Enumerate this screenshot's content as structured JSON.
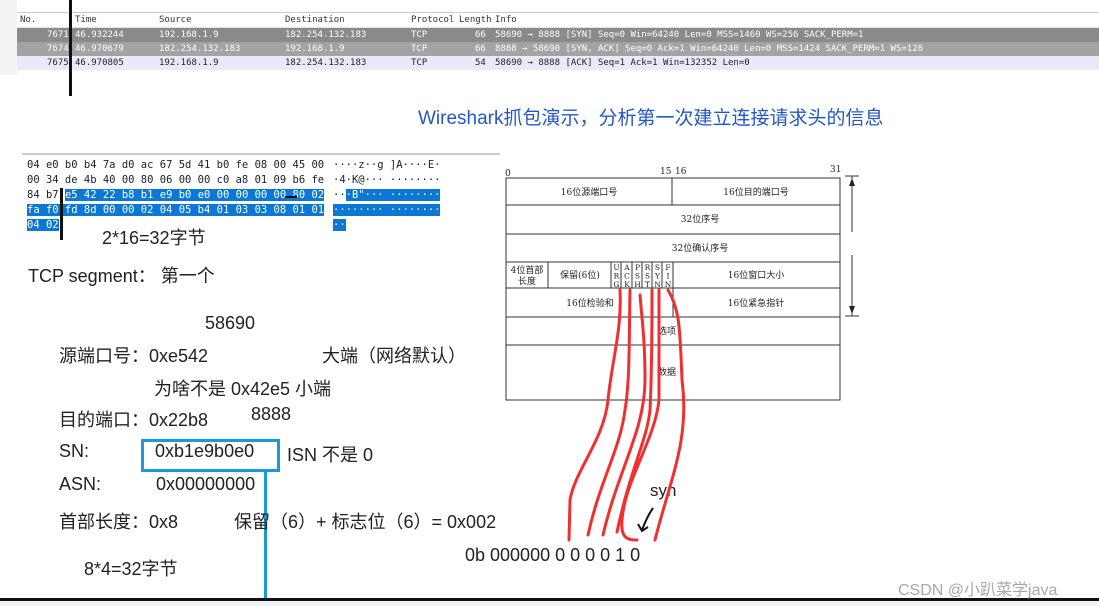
{
  "packet_list": {
    "columns": [
      "No.",
      "Time",
      "Source",
      "Destination",
      "Protocol",
      "Length",
      "Info"
    ],
    "rows": [
      {
        "no": "7671",
        "time": "46.932244",
        "source": "192.168.1.9",
        "destination": "182.254.132.183",
        "protocol": "TCP",
        "length": "66",
        "info": "58690 → 8888 [SYN] Seq=0 Win=64240 Len=0 MSS=1460 WS=256 SACK_PERM=1"
      },
      {
        "no": "7674",
        "time": "46.970679",
        "source": "182.254.132.183",
        "destination": "192.168.1.9",
        "protocol": "TCP",
        "length": "66",
        "info": "8888 → 58690 [SYN, ACK] Seq=0 Ack=1 Win=64240 Len=0 MSS=1424 SACK_PERM=1 WS=128"
      },
      {
        "no": "7675",
        "time": "46.970805",
        "source": "192.168.1.9",
        "destination": "182.254.132.183",
        "protocol": "TCP",
        "length": "54",
        "info": "58690 → 8888 [ACK] Seq=1 Ack=1 Win=132352 Len=0"
      }
    ]
  },
  "title": "Wireshark抓包演示，分析第一次建立连接请求头的信息",
  "hex_dump": {
    "lines": [
      {
        "plain": "04 e0 b0 b4 7a d0 ac 67  5d 41 b0 fe 08 00 45 00",
        "sel": "",
        "ascii": "····z··g ]A····E·",
        "ascii_sel": ""
      },
      {
        "plain": "00 34 de 4b 40 00 80 06  00 00 c0 a8 01 09 b6 fe",
        "sel": "",
        "ascii": "·4·K@··· ········",
        "ascii_sel": ""
      },
      {
        "plain": "84 b7 ",
        "sel": "e5 42 22 b8 b1 e9  b0 e0 00 00 00 00 80 02",
        "ascii": "··",
        "ascii_sel": "·B\"··· ········"
      },
      {
        "plain": "",
        "sel": "fa f0 fd 8d 00 00 02 04  05 b4 01 03 03 08 01 01",
        "ascii": "",
        "ascii_sel": "········ ········"
      },
      {
        "plain": "",
        "sel": "04 02",
        "ascii": "",
        "ascii_sel": "··"
      }
    ]
  },
  "notes": {
    "bytes_count": "2*16=32字节",
    "segment": "TCP segment： 第一个",
    "src_port_dec": "58690",
    "src_port_label": "源端口号：0xe542",
    "big_endian": "大端（网络默认）",
    "why_not": "为啥不是 0x42e5   小端",
    "dst_port_label": "目的端口：0x22b8",
    "dst_port_dec": "8888",
    "sn_label": "SN:",
    "sn_value": "0xb1e9b0e0",
    "isn_note": "ISN 不是 0",
    "asn_label": "ASN:",
    "asn_value": "0x00000000",
    "header_len": "首部长度：0x8",
    "reserved_flags": "保留（6）+ 标志位（6）= 0x002",
    "header_bytes": "8*4=32字节",
    "syn": "syn",
    "binary": "0b 000000 0 0 0 0 1 0"
  },
  "diagram": {
    "bit_0": "0",
    "bit_15": "15",
    "bit_16": "16",
    "bit_31": "31",
    "src_port": "16位源端口号",
    "dst_port": "16位目的端口号",
    "seq": "32位序号",
    "ack": "32位确认序号",
    "hdr_len": [
      "4位首部",
      "长度"
    ],
    "reserved": "保留(6位)",
    "flags": [
      "URG",
      "ACK",
      "PSH",
      "RST",
      "SYN",
      "FIN"
    ],
    "window": "16位窗口大小",
    "checksum": "16位检验和",
    "urgent": "16位紧急指针",
    "options": "选项",
    "data": "数据"
  },
  "colors": {
    "accent_blue": "#2457c5",
    "selection": "#0a78d4",
    "box_blue": "#1a9ad8",
    "annotation_red": "#f03030"
  },
  "watermark": "CSDN @小趴菜学java"
}
